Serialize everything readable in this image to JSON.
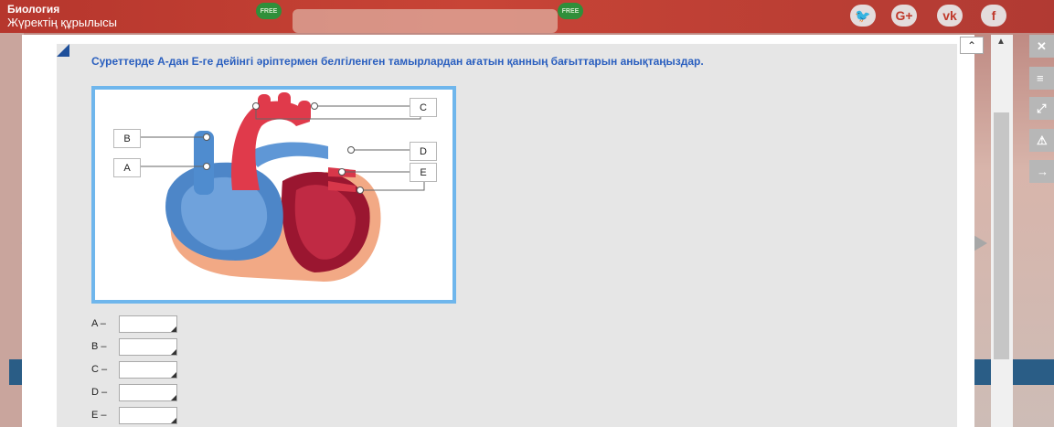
{
  "app": {
    "subject": "Биология",
    "topic": "Жүректің құрылысы",
    "free_badges": [
      "FREE",
      "FREE"
    ],
    "social_icons": [
      "twitter-icon",
      "google-plus-icon",
      "vk-icon",
      "facebook-icon"
    ],
    "social_labels": [
      "🐦",
      "G+",
      "vk",
      "f"
    ]
  },
  "question": {
    "text": "Суреттерде А-дан Е-ге дейінгі әріптермен белгіленген тамырлардан ағатын қанның бағыттарын анықтаңыздар."
  },
  "figure": {
    "labels": [
      "B",
      "A",
      "C",
      "D",
      "E"
    ]
  },
  "answers": [
    {
      "label": "A –",
      "value": ""
    },
    {
      "label": "B –",
      "value": ""
    },
    {
      "label": "C –",
      "value": ""
    },
    {
      "label": "D –",
      "value": ""
    },
    {
      "label": "E –",
      "value": ""
    }
  ],
  "toolbar": {
    "buttons": [
      "✕",
      "≡",
      "⤢",
      "⚠",
      "→"
    ],
    "icons": [
      "close-icon",
      "menu-icon",
      "expand-icon",
      "warning-icon",
      "next-icon"
    ]
  },
  "scroll": {
    "up_icon": "⌃",
    "arrow": "▲"
  },
  "colors": {
    "accent": "#2a5fbf",
    "figure_border": "#6fb6ec",
    "topbar": "#c84436"
  }
}
